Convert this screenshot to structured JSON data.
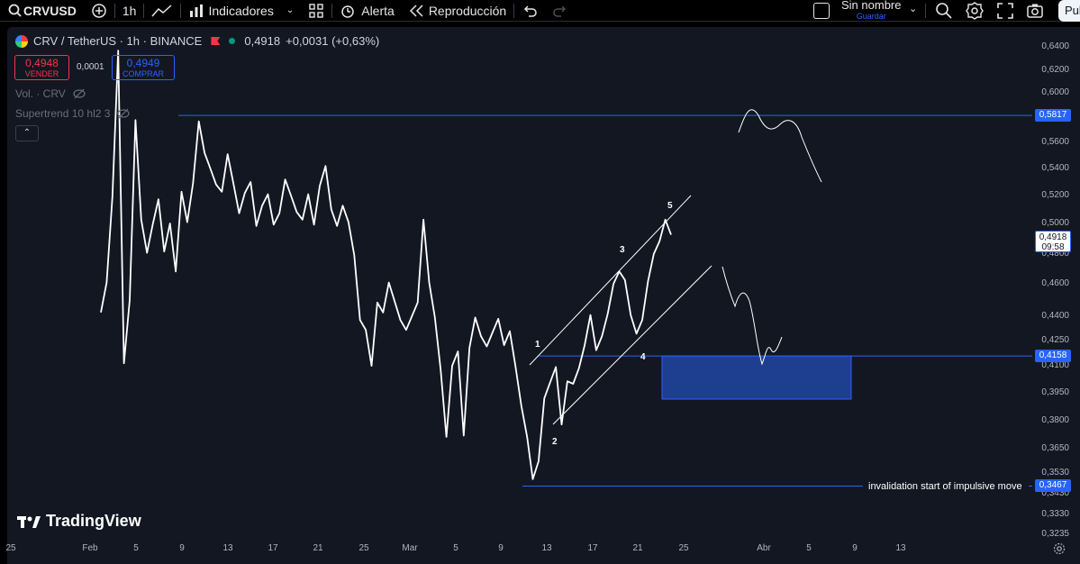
{
  "toolbar": {
    "symbol": "CRVUSD",
    "interval": "1h",
    "indicators_label": "Indicadores",
    "alert_label": "Alerta",
    "replay_label": "Reproducción",
    "layout_name": "Sin nombre",
    "save_label": "Guardar",
    "publish_label": "Pub"
  },
  "legend": {
    "pair": "CRV / TetherUS · 1h · BINANCE",
    "price": "0,4918",
    "change": "+0,0031 (+0,63%)",
    "sell_price": "0,4948",
    "sell_label": "VENDER",
    "spread": "0,0001",
    "buy_price": "0,4949",
    "buy_label": "COMPRAR",
    "vol_label": "Vol. · CRV",
    "supertrend_label": "Supertrend 10 hl2 3"
  },
  "colors": {
    "background": "#131722",
    "price_line": "#ffffff",
    "level_line": "#2962ff",
    "zone_fill": "#1e3f8f",
    "sell": "#f23645",
    "buy": "#2962ff"
  },
  "chart_data": {
    "type": "line",
    "title": "CRV / TetherUS · 1h · BINANCE",
    "x_axis_ticks": [
      "25",
      "Feb",
      "5",
      "9",
      "13",
      "17",
      "21",
      "25",
      "Mar",
      "5",
      "9",
      "13",
      "17",
      "21",
      "25",
      "Abr",
      "5",
      "9",
      "13"
    ],
    "y_axis_ticks": [
      "0,6400",
      "0,6200",
      "0,6000",
      "0,5600",
      "0,5400",
      "0,5200",
      "0,5000",
      "0,4800",
      "0,4600",
      "0,4400",
      "0,4250",
      "0,4100",
      "0,3950",
      "0,3800",
      "0,3650",
      "0,3530",
      "0,3430",
      "0,3330",
      "0,3235"
    ],
    "ylim": [
      0.3235,
      0.64
    ],
    "series": [
      {
        "values": [
          0.44,
          0.46,
          0.52,
          0.64,
          0.41,
          0.45,
          0.58,
          0.5,
          0.48,
          0.5,
          0.52,
          0.48,
          0.5,
          0.47,
          0.52,
          0.5,
          0.53,
          0.58,
          0.55,
          0.54,
          0.53,
          0.52,
          0.55,
          0.53,
          0.51,
          0.52,
          0.53,
          0.5,
          0.51,
          0.52,
          0.5,
          0.51,
          0.53,
          0.52,
          0.51,
          0.5,
          0.52,
          0.5,
          0.53,
          0.54,
          0.51,
          0.5,
          0.51,
          0.5,
          0.48,
          0.44,
          0.43,
          0.41,
          0.45,
          0.44,
          0.46,
          0.45,
          0.44,
          0.43,
          0.44,
          0.45,
          0.5,
          0.46,
          0.44,
          0.41,
          0.37,
          0.41,
          0.42,
          0.37,
          0.42,
          0.44,
          0.43,
          0.42,
          0.43,
          0.44,
          0.42,
          0.43,
          0.41,
          0.39,
          0.37,
          0.35,
          0.36,
          0.39,
          0.4,
          0.41,
          0.38,
          0.4,
          0.4,
          0.41,
          0.42,
          0.44,
          0.42,
          0.43,
          0.44,
          0.46,
          0.47,
          0.46,
          0.44,
          0.43,
          0.44,
          0.46,
          0.48,
          0.49,
          0.5,
          0.4918
        ]
      }
    ],
    "levels": [
      {
        "value": 0.5817,
        "label": "0,5817"
      },
      {
        "value": 0.4158,
        "label": "0,4158"
      },
      {
        "value": 0.3467,
        "label": "0,3467",
        "annotation": "invalidation start of impulsive move"
      }
    ],
    "last_price": {
      "value": 0.4918,
      "label": "0,4918",
      "countdown": "09:58"
    },
    "wave_labels": [
      "1",
      "2",
      "3",
      "4",
      "5"
    ],
    "zone": {
      "from": 0.396,
      "to": 0.4158
    },
    "watermark": "TradingView"
  }
}
